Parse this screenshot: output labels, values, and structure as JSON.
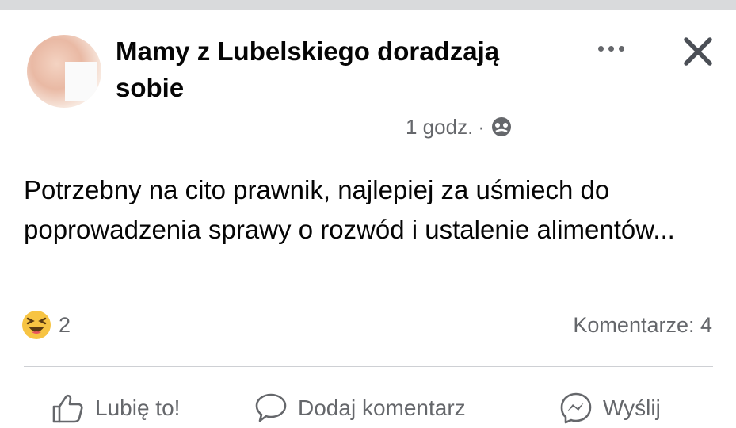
{
  "post": {
    "group_name": "Mamy z Lubelskiego doradzają sobie",
    "time": "1 godz.",
    "separator": "·",
    "privacy_icon": "globe-icon",
    "text": "Potrzebny na cito prawnik, najlepiej za uśmiech do poprowadzenia sprawy o rozwód i ustalenie alimentów...",
    "reaction_icon": "haha-icon",
    "reaction_count": "2",
    "comments_label": "Komentarze: 4"
  },
  "actions": {
    "like": "Lubię to!",
    "comment": "Dodaj komentarz",
    "send": "Wyślij"
  },
  "colors": {
    "secondary_text": "#65676b",
    "divider": "#ced0d4",
    "top_strip": "#d9dadc"
  }
}
